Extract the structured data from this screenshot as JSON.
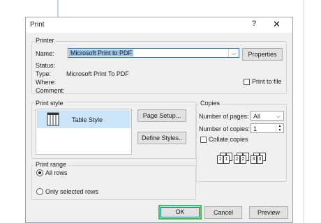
{
  "dialog": {
    "title": "Print",
    "help_label": "?",
    "close_label": "✕"
  },
  "printer": {
    "section_label": "Printer",
    "name_label": "Name:",
    "name_value": "Microsoft Print to PDF",
    "properties_label": "Properties",
    "status_label": "Status:",
    "type_label": "Type:",
    "type_value": "Microsoft Print To PDF",
    "where_label": "Where:",
    "comment_label": "Comment:",
    "print_to_file_label": "Print to file",
    "print_to_file_checked": false
  },
  "print_style": {
    "section_label": "Print style",
    "items": [
      {
        "label": "Table Style",
        "icon": "table-style-icon",
        "selected": true
      }
    ],
    "page_setup_label": "Page Setup...",
    "define_styles_label": "Define Styles.."
  },
  "copies": {
    "section_label": "Copies",
    "num_pages_label": "Number of pages:",
    "num_pages_value": "All",
    "num_copies_label": "Number of copies:",
    "num_copies_value": "1",
    "collate_label": "Collate copies",
    "collate_checked": false,
    "collate_pages": [
      "1",
      "1",
      "2",
      "2",
      "3",
      "3"
    ]
  },
  "print_range": {
    "section_label": "Print range",
    "all_rows_label": "All rows",
    "selected_rows_label": "Only selected rows",
    "selected": "all_rows"
  },
  "footer": {
    "ok_label": "OK",
    "cancel_label": "Cancel",
    "preview_label": "Preview"
  },
  "colors": {
    "selection": "#cce4f7",
    "highlight_border": "#2bd33a",
    "combo_highlight": "#9ac4ec"
  }
}
